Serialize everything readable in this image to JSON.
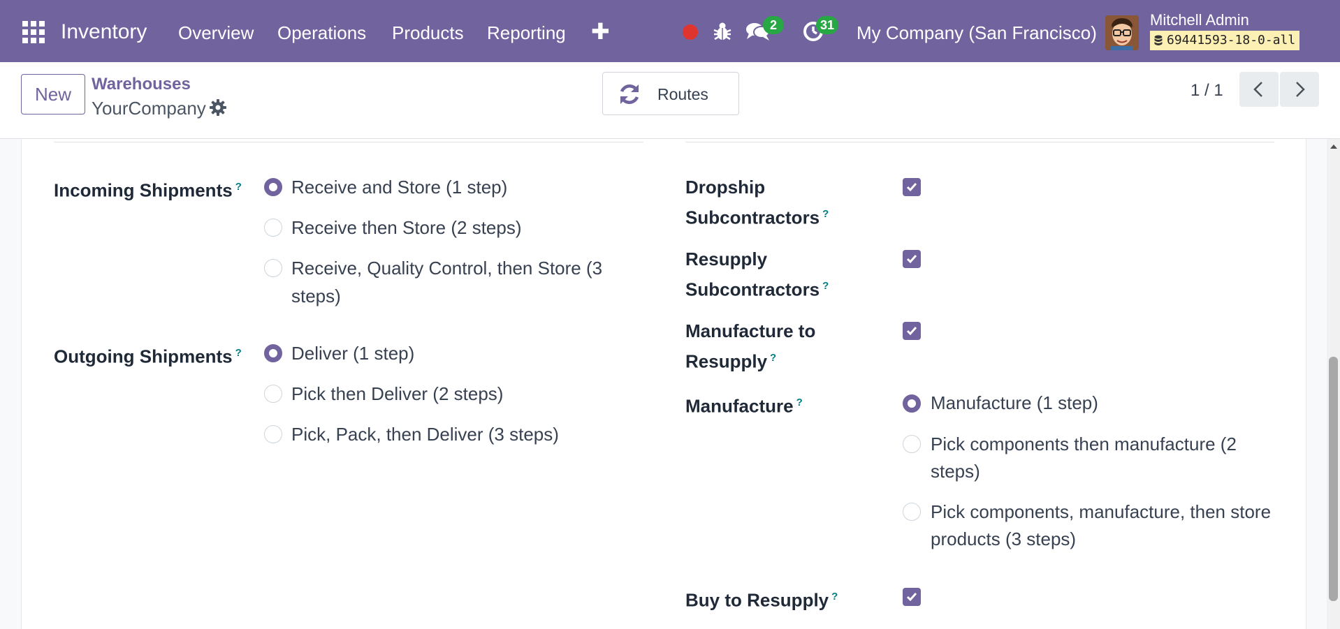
{
  "navbar": {
    "app_name": "Inventory",
    "menu": [
      "Overview",
      "Operations",
      "Products",
      "Reporting"
    ],
    "plus": "✚",
    "messages_count": "2",
    "activities_count": "31",
    "company": "My Company (San Francisco)",
    "user_name": "Mitchell Admin",
    "database": "69441593-18-0-all",
    "colors": {
      "background": "#71639e",
      "badge": "#28a745",
      "record": "#e0342f"
    }
  },
  "control_panel": {
    "new_button": "New",
    "breadcrumb": "Warehouses",
    "record_name": "YourCompany",
    "routes_button": "Routes",
    "pager": "1 / 1"
  },
  "form": {
    "incoming": {
      "label": "Incoming Shipments",
      "help": "?",
      "options": [
        {
          "label": "Receive and Store (1 step)",
          "checked": true
        },
        {
          "label": "Receive then Store (2 steps)",
          "checked": false
        },
        {
          "label_line1": "Receive, Quality Control, then Store (3",
          "label_line2": "steps)",
          "checked": false
        }
      ]
    },
    "outgoing": {
      "label": "Outgoing Shipments",
      "help": "?",
      "options": [
        {
          "label": "Deliver (1 step)",
          "checked": true
        },
        {
          "label": "Pick then Deliver (2 steps)",
          "checked": false
        },
        {
          "label": "Pick, Pack, then Deliver (3 steps)",
          "checked": false
        }
      ]
    },
    "dropship_subcontractors": {
      "line1": "Dropship",
      "line2": "Subcontractors",
      "help": "?",
      "checked": true
    },
    "resupply_subcontractors": {
      "line1": "Resupply",
      "line2": "Subcontractors",
      "help": "?",
      "checked": true
    },
    "manufacture_to_resupply": {
      "line1": "Manufacture to",
      "line2": "Resupply",
      "help": "?",
      "checked": true
    },
    "manufacture": {
      "label": "Manufacture",
      "help": "?",
      "options": [
        {
          "label": "Manufacture (1 step)",
          "checked": true
        },
        {
          "label_line1": "Pick components then manufacture (2",
          "label_line2": "steps)",
          "checked": false
        },
        {
          "label_line1": "Pick components, manufacture, then store",
          "label_line2": "products (3 steps)",
          "checked": false
        }
      ]
    },
    "buy_to_resupply": {
      "label": "Buy to Resupply",
      "help": "?",
      "checked": true
    },
    "accent_color": "#71639e"
  }
}
